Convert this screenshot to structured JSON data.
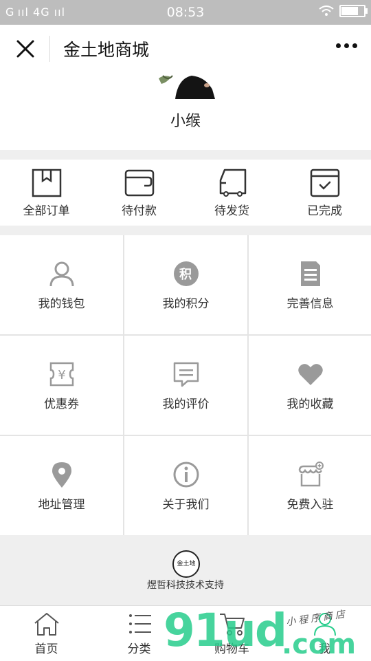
{
  "status_bar": {
    "left": "G ııl 4G ııl",
    "time": "08:53"
  },
  "header": {
    "title": "金土地商城"
  },
  "profile": {
    "name": "小缑"
  },
  "orders": [
    {
      "label": "全部订单",
      "icon": "box-icon"
    },
    {
      "label": "待付款",
      "icon": "wallet-icon"
    },
    {
      "label": "待发货",
      "icon": "truck-icon"
    },
    {
      "label": "已完成",
      "icon": "check-calendar-icon"
    }
  ],
  "menu": [
    {
      "label": "我的钱包",
      "icon": "user-icon"
    },
    {
      "label": "我的积分",
      "icon": "points-icon",
      "glyph": "积"
    },
    {
      "label": "完善信息",
      "icon": "document-icon"
    },
    {
      "label": "优惠券",
      "icon": "coupon-icon",
      "glyph": "¥"
    },
    {
      "label": "我的评价",
      "icon": "comment-icon"
    },
    {
      "label": "我的收藏",
      "icon": "heart-icon"
    },
    {
      "label": "地址管理",
      "icon": "location-icon"
    },
    {
      "label": "关于我们",
      "icon": "info-icon"
    },
    {
      "label": "免费入驻",
      "icon": "store-icon"
    }
  ],
  "support": {
    "logo_text": "金土地",
    "text": "煜哲科技技术支持"
  },
  "tabs": [
    {
      "label": "首页",
      "icon": "home-icon"
    },
    {
      "label": "分类",
      "icon": "list-icon"
    },
    {
      "label": "购物车",
      "icon": "cart-icon"
    },
    {
      "label": "我",
      "icon": "person-icon"
    }
  ],
  "watermark": {
    "main": "91ud",
    "suffix": ".com",
    "handwritten": "小程序商店"
  },
  "colors": {
    "accent_watermark": "#27cd8c",
    "icon_gray": "#9a9a9a"
  }
}
